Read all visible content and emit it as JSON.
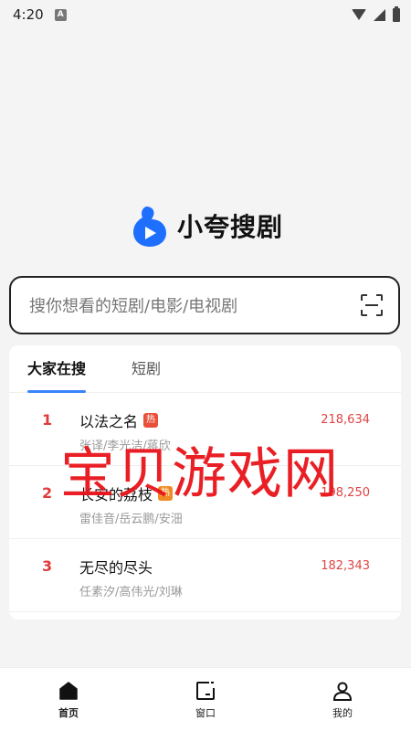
{
  "status_bar": {
    "time": "4:20",
    "notification_letter": "A"
  },
  "logo": {
    "app_name": "小夸搜剧",
    "brand_color": "#1f6fff"
  },
  "search": {
    "placeholder": "搜你想看的短剧/电影/电视剧"
  },
  "tabs": [
    {
      "label": "大家在搜",
      "active": true
    },
    {
      "label": "短剧",
      "active": false
    }
  ],
  "rankings": [
    {
      "rank": "1",
      "title": "以法之名",
      "badge": "热",
      "badge_color": "#e8503a",
      "cast": "张译/李光洁/蒋欣",
      "score": "218,634"
    },
    {
      "rank": "2",
      "title": "长安的荔枝",
      "badge": "热",
      "badge_color": "#f08a24",
      "cast": "雷佳音/岳云鹏/安沺",
      "score": "198,250"
    },
    {
      "rank": "3",
      "title": "无尽的尽头",
      "badge": "",
      "badge_color": "",
      "cast": "任素汐/高伟光/刘琳",
      "score": "182,343"
    }
  ],
  "watermark": {
    "text": "宝贝游戏网",
    "color": "#e8141a"
  },
  "bottom_nav": [
    {
      "label": "首页",
      "icon": "home-icon",
      "active": true
    },
    {
      "label": "窗口",
      "icon": "window-icon",
      "active": false
    },
    {
      "label": "我的",
      "icon": "profile-icon",
      "active": false
    }
  ]
}
